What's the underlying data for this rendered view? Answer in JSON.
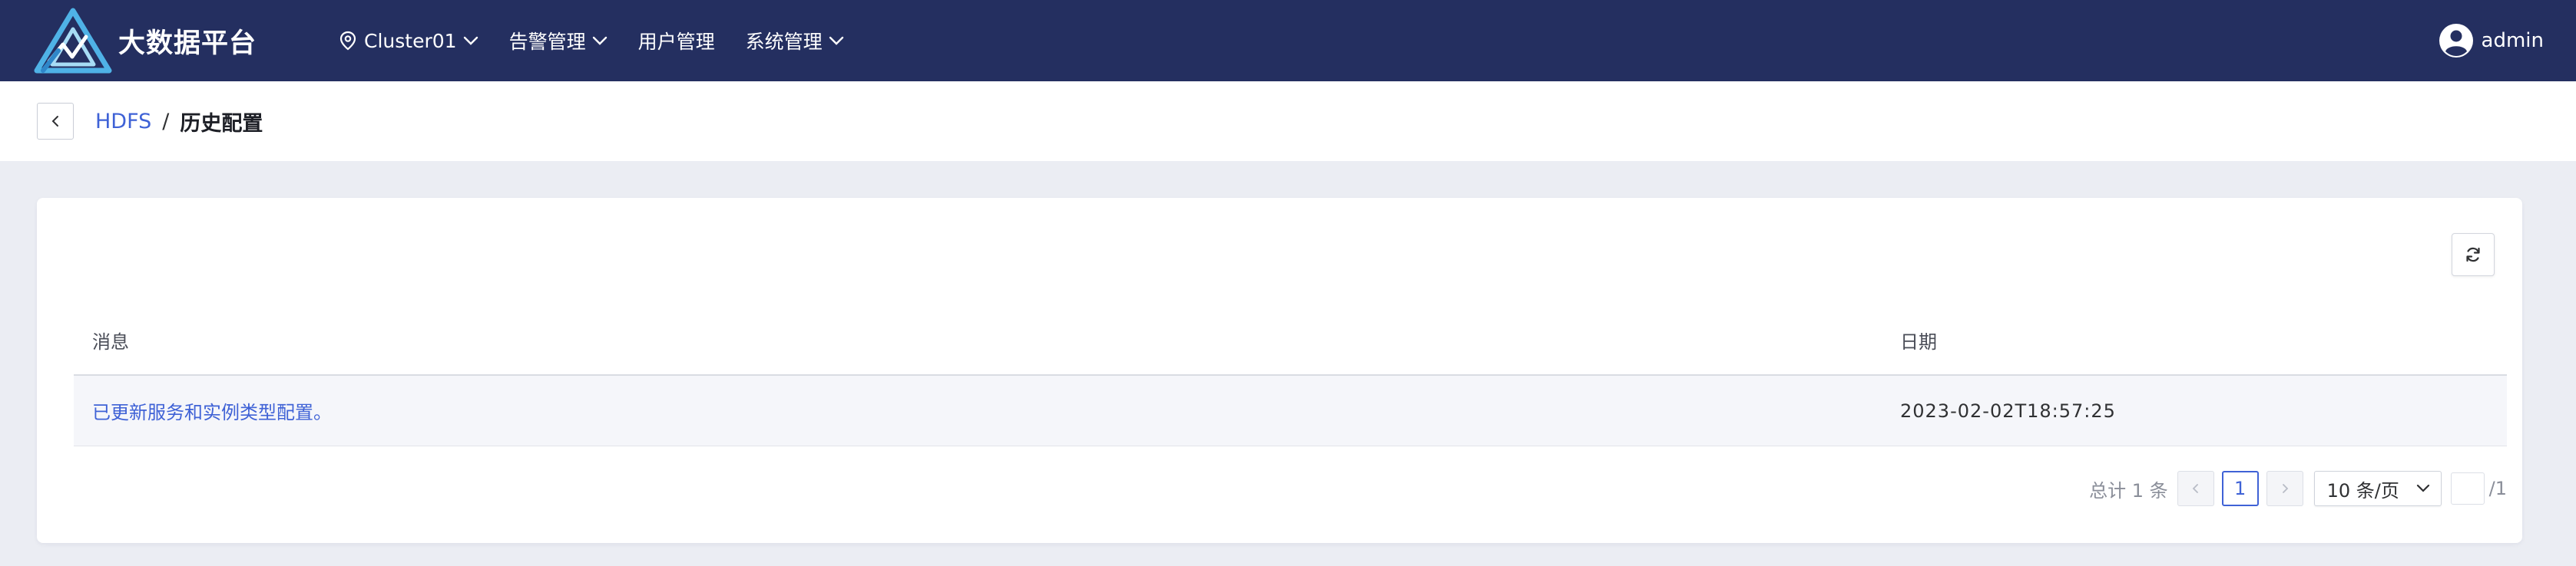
{
  "app": {
    "title": "大数据平台",
    "brand_color": "#242f60",
    "accent_color": "#3f62d6"
  },
  "nav": {
    "cluster": {
      "label": "Cluster01",
      "icon": "location-pin-icon"
    },
    "alerts": {
      "label": "告警管理"
    },
    "users": {
      "label": "用户管理"
    },
    "system": {
      "label": "系统管理"
    }
  },
  "user": {
    "name": "admin",
    "icon": "user-avatar-icon"
  },
  "breadcrumb": {
    "parent": "HDFS",
    "separator": "/",
    "current": "历史配置"
  },
  "table": {
    "columns": {
      "message": "消息",
      "date": "日期"
    },
    "rows": [
      {
        "message": "已更新服务和实例类型配置。",
        "date": "2023-02-02T18:57:25"
      }
    ]
  },
  "pagination": {
    "total_label": "总计 1 条",
    "current_page": "1",
    "page_size": "10 条/页",
    "jump_value": "",
    "page_count": "/1"
  }
}
